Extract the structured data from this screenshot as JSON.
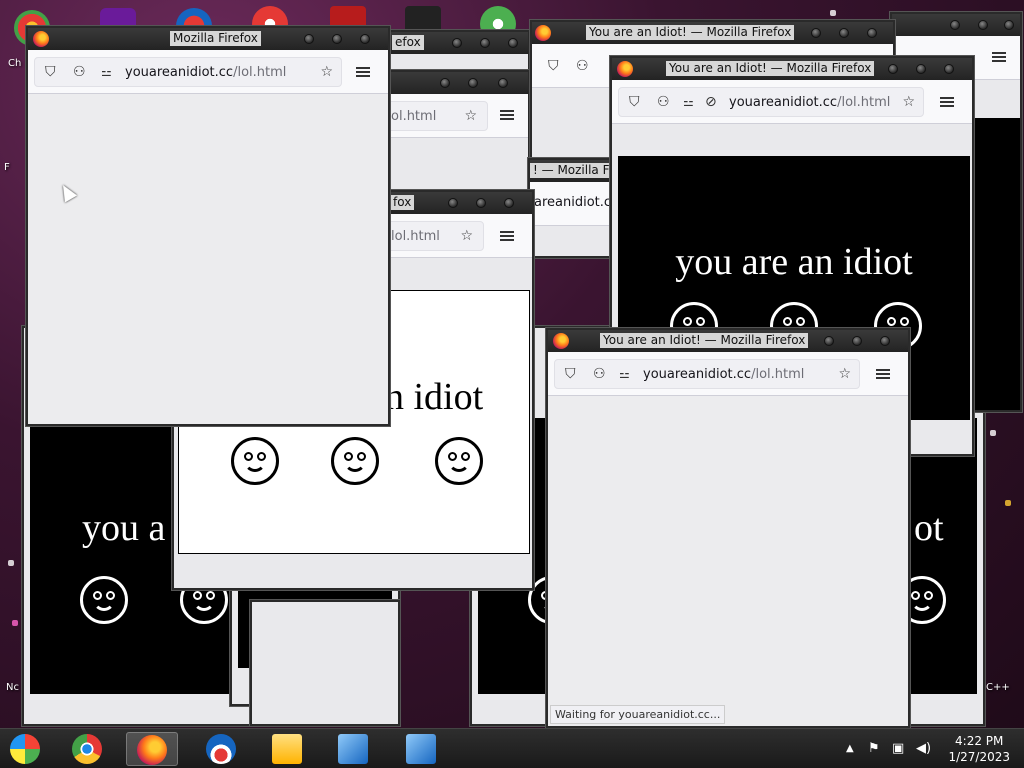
{
  "desktop": {
    "icon_labels": [
      "Ch D",
      "F",
      "Nc",
      "C++"
    ]
  },
  "windows": {
    "w_top_left": {
      "title": "Mozilla Firefox",
      "url_domain": "youareanidiot.cc",
      "url_path": "/lol.html"
    },
    "w_back1": {
      "title_fragment": "efox"
    },
    "w_back2": {
      "url_path": "ol.html"
    },
    "w_center": {
      "title_fragment": "fox",
      "url_path": "lol.html",
      "text": "n idiot"
    },
    "w_top_mid": {
      "title": "You are an Idiot! — Mozilla Firefox"
    },
    "w_mid_peek": {
      "title_fragment": "! — Mozilla Fir",
      "url_fragment": "areanidiot.cc"
    },
    "w_right": {
      "title": "You are an Idiot! — Mozilla Firefox",
      "url_domain": "youareanidiot.cc",
      "url_path": "/lol.html",
      "text": "you are an idiot"
    },
    "w_bottom_right": {
      "title": "You are an Idiot! — Mozilla Firefox",
      "url_domain": "youareanidiot.cc",
      "url_path": "/lol.html",
      "status": "Waiting for youareanidiot.cc..."
    },
    "w_bottom_left": {
      "text": "you a"
    },
    "w_bottom_right_bg": {
      "text": "ot"
    }
  },
  "taskbar": {
    "items": [
      "start",
      "chrome",
      "firefox",
      "obama",
      "explorer",
      "installer1",
      "installer2"
    ],
    "clock_time": "4:22 PM",
    "clock_date": "1/27/2023"
  },
  "colors": {
    "titlebar": "#2a2a2a",
    "window_bg": "#e9e9ec",
    "desktop": "#3a1430"
  }
}
